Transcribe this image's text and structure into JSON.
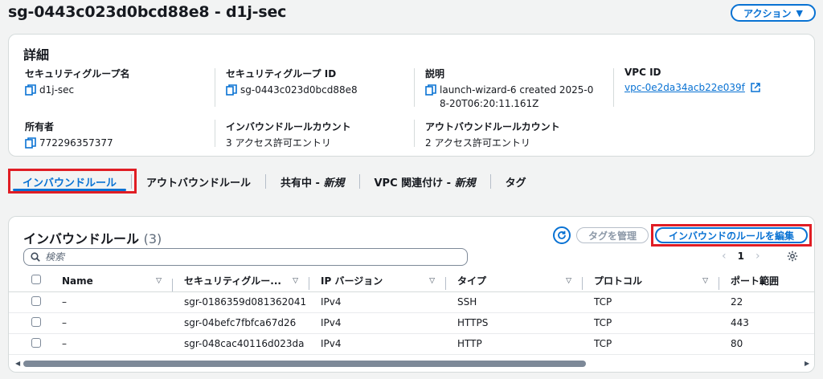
{
  "header": {
    "title": "sg-0443c023d0bcd88e8 - d1j-sec",
    "action_label": "アクション"
  },
  "details": {
    "title": "詳細",
    "fields": [
      {
        "label": "セキュリティグループ名",
        "value": "d1j-sec"
      },
      {
        "label": "セキュリティグループ ID",
        "value": "sg-0443c023d0bcd88e8"
      },
      {
        "label": "説明",
        "value": "launch-wizard-6 created 2025-08-20T06:20:11.161Z"
      },
      {
        "label": "VPC ID",
        "value": "vpc-0e2da34acb22e039f"
      },
      {
        "label": "所有者",
        "value": "772296357377"
      },
      {
        "label": "インバウンドルールカウント",
        "value": "3 アクセス許可エントリ"
      },
      {
        "label": "アウトバウンドルールカウント",
        "value": "2 アクセス許可エントリ"
      }
    ]
  },
  "tabs": [
    {
      "label": "インバウンドルール",
      "suffix": ""
    },
    {
      "label": "アウトバウンドルール",
      "suffix": ""
    },
    {
      "label": "共有中 - ",
      "suffix": "新規"
    },
    {
      "label": "VPC 関連付け - ",
      "suffix": "新規"
    },
    {
      "label": "タグ",
      "suffix": ""
    }
  ],
  "rules": {
    "title": "インバウンドルール",
    "count": "(3)",
    "manage_tags_label": "タグを管理",
    "edit_label": "インバウンドのルールを編集",
    "search_placeholder": "検索",
    "page": "1",
    "columns": [
      "Name",
      "セキュリティグルー...",
      "IP バージョン",
      "タイプ",
      "プロトコル",
      "ポート範囲"
    ],
    "rows": [
      {
        "name": "–",
        "rule_id": "sgr-0186359d081362041",
        "ip": "IPv4",
        "type": "SSH",
        "protocol": "TCP",
        "port": "22"
      },
      {
        "name": "–",
        "rule_id": "sgr-04befc7fbfca67d26",
        "ip": "IPv4",
        "type": "HTTPS",
        "protocol": "TCP",
        "port": "443"
      },
      {
        "name": "–",
        "rule_id": "sgr-048cac40116d023da",
        "ip": "IPv4",
        "type": "HTTP",
        "protocol": "TCP",
        "port": "80"
      }
    ]
  },
  "colors": {
    "accent": "#0972d3",
    "highlight": "#e01d24"
  }
}
